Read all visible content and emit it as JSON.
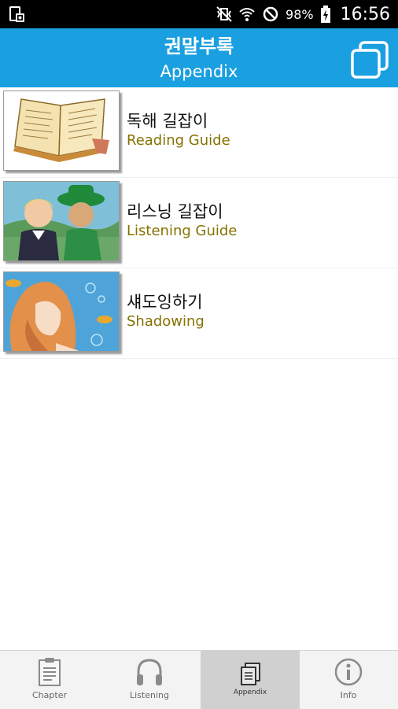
{
  "status_bar": {
    "battery_percent": "98%",
    "time": "16:56",
    "icons": [
      "sim-card-icon",
      "vibrate-mute-icon",
      "wifi-icon",
      "do-not-disturb-icon",
      "battery-charging-icon"
    ]
  },
  "app_bar": {
    "title": "권말부록",
    "subtitle": "Appendix",
    "action_icon": "copy-pages-icon",
    "color": "#1a9fe0"
  },
  "list": {
    "items": [
      {
        "title": "독해 길잡이",
        "subtitle": "Reading Guide",
        "thumbnail": "open-book-illustration"
      },
      {
        "title": "리스닝 길잡이",
        "subtitle": "Listening Guide",
        "thumbnail": "two-characters-illustration"
      },
      {
        "title": "섀도잉하기",
        "subtitle": "Shadowing",
        "thumbnail": "mermaid-illustration"
      }
    ],
    "subtitle_color": "#857200"
  },
  "tab_bar": {
    "tabs": [
      {
        "label": "Chapter",
        "icon": "clipboard-icon",
        "active": false
      },
      {
        "label": "Listening",
        "icon": "headphones-icon",
        "active": false
      },
      {
        "label": "Appendix",
        "icon": "pages-icon",
        "active": true
      },
      {
        "label": "Info",
        "icon": "info-icon",
        "active": false
      }
    ]
  }
}
